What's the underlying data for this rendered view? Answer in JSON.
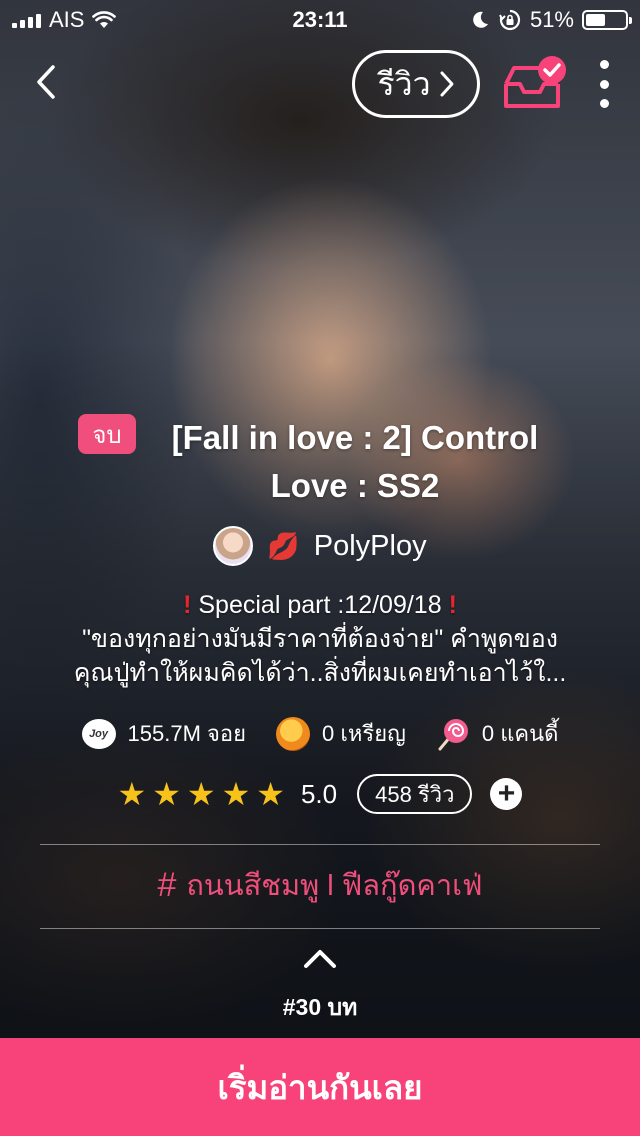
{
  "status_bar": {
    "carrier": "AIS",
    "time": "23:11",
    "battery_percent": "51%",
    "battery_level": 0.51
  },
  "nav": {
    "review_label": "รีวิว"
  },
  "story": {
    "status_badge": "จบ",
    "title": "[Fall in love : 2] Control Love : SS2",
    "author": "PolyPloy",
    "description_line1": "Special part :12/09/18",
    "description_line2": "\"ของทุกอย่างมันมีราคาที่ต้องจ่าย\" คำพูดของ",
    "description_line3": "คุณปู่ทำให้ผมคิดได้ว่า..สิ่งที่ผมเคยทำเอาไว้ใ..."
  },
  "stats": {
    "joy_icon_text": "Joy",
    "joy": "155.7M จอย",
    "coins": "0 เหรียญ",
    "candy": "0 แคนดี้"
  },
  "rating": {
    "stars": 5,
    "value": "5.0",
    "review_count": "458 รีวิว"
  },
  "tags": {
    "label": "ถนนสีชมพู l ฟีลกู๊ดคาเฟ่"
  },
  "episodes": {
    "count_label": "#30 บท"
  },
  "cta": {
    "start_label": "เริ่มอ่านกันเลย"
  },
  "colors": {
    "accent_pink": "#f7437a",
    "badge_pink": "#f04e7c",
    "star_yellow": "#f7c21a"
  }
}
